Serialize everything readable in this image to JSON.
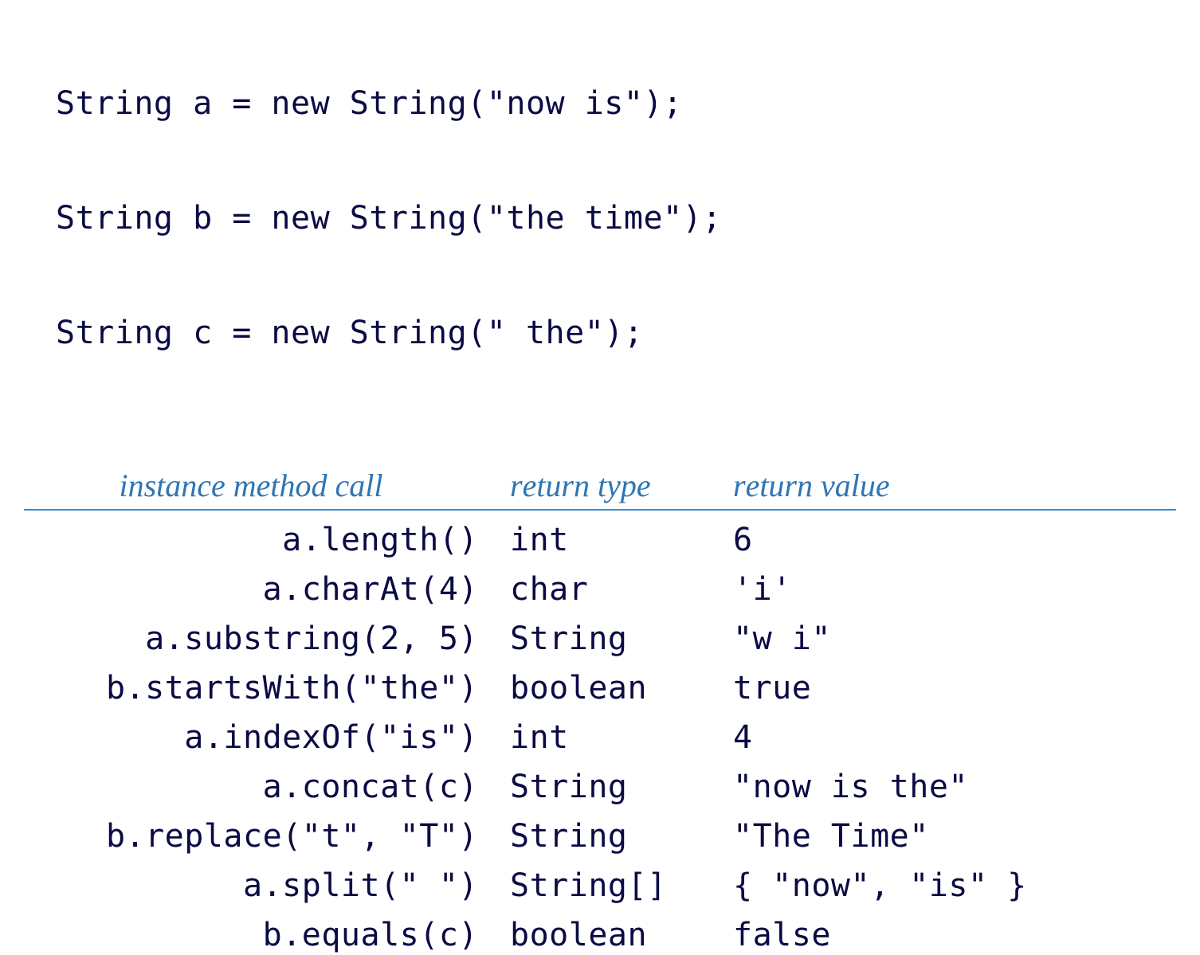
{
  "code": {
    "line1": "String a = new String(\"now is\");",
    "line2": "String b = new String(\"the time\");",
    "line3": "String c = new String(\" the\");"
  },
  "headers": {
    "col1": "instance method call",
    "col2": "return type",
    "col3": "return value"
  },
  "rows": [
    {
      "call": "a.length()",
      "type": "int",
      "value": "6"
    },
    {
      "call": "a.charAt(4)",
      "type": "char",
      "value": "'i'"
    },
    {
      "call": "a.substring(2, 5)",
      "type": "String",
      "value": "\"w i\""
    },
    {
      "call": "b.startsWith(\"the\")",
      "type": "boolean",
      "value": "true"
    },
    {
      "call": "a.indexOf(\"is\")",
      "type": "int",
      "value": "4"
    },
    {
      "call": "a.concat(c)",
      "type": "String",
      "value": "\"now is the\""
    },
    {
      "call": "b.replace(\"t\", \"T\")",
      "type": "String",
      "value": "\"The Time\""
    },
    {
      "call": "a.split(\" \")",
      "type": "String[]",
      "value": "{ \"now\", \"is\" }"
    },
    {
      "call": "b.equals(c)",
      "type": "boolean",
      "value": "false"
    }
  ]
}
